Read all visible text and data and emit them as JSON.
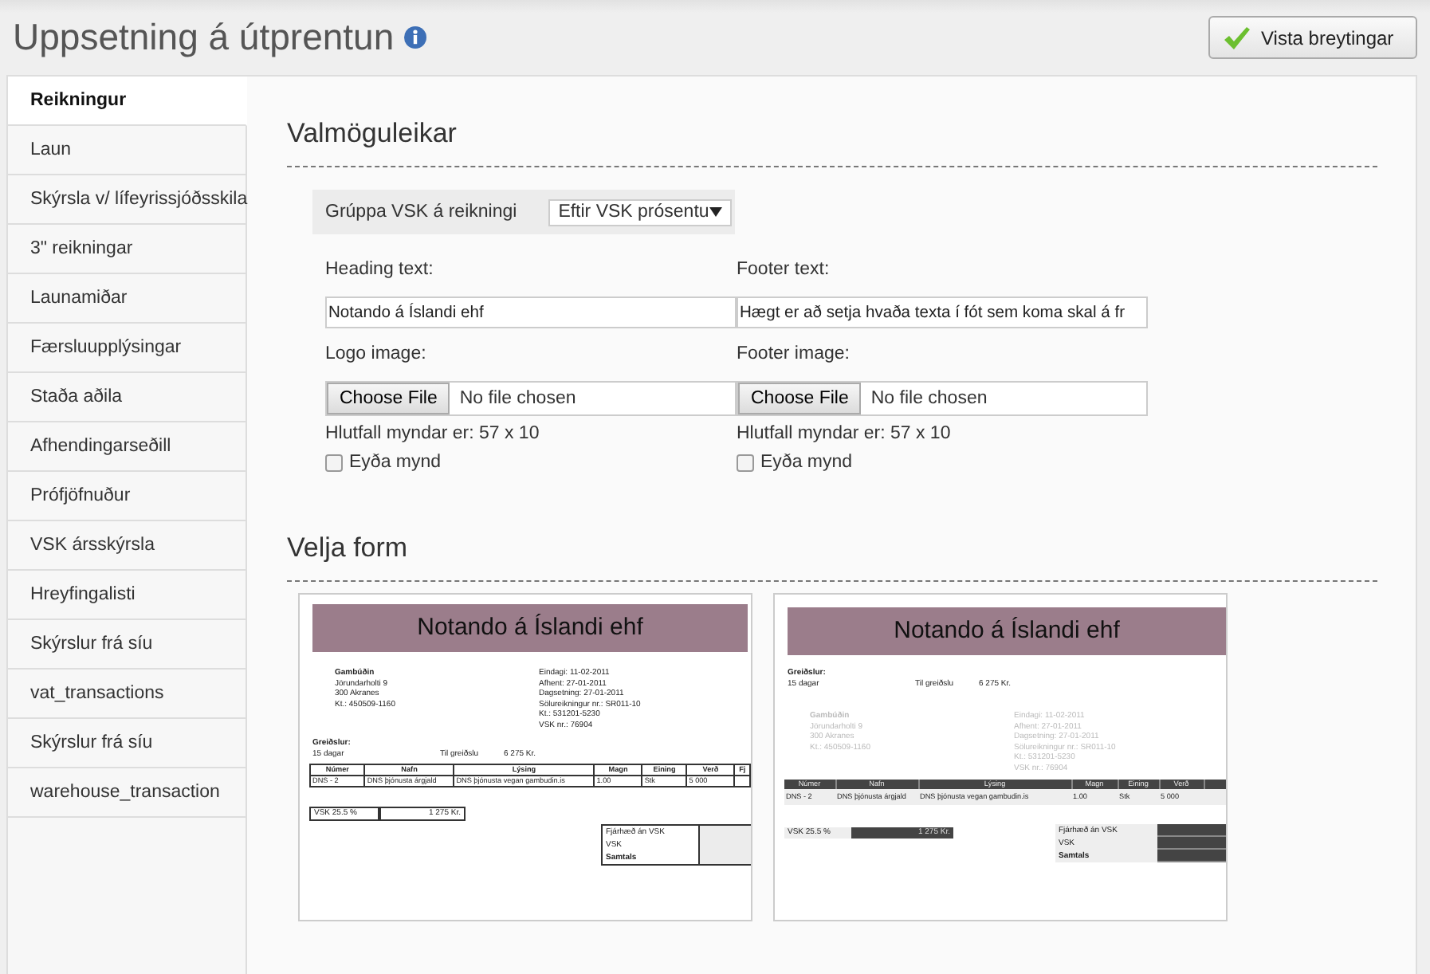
{
  "page": {
    "title": "Uppsetning á útprentun",
    "save_button": "Vista breytingar"
  },
  "sidebar": {
    "items": [
      {
        "label": "Reikningur",
        "selected": true
      },
      {
        "label": "Laun",
        "selected": false
      },
      {
        "label": "Skýrsla v/ lífeyrissjóðsskila",
        "selected": false
      },
      {
        "label": "3\" reikningar",
        "selected": false
      },
      {
        "label": "Launamiðar",
        "selected": false
      },
      {
        "label": "Færsluupplýsingar",
        "selected": false
      },
      {
        "label": "Staða aðila",
        "selected": false
      },
      {
        "label": "Afhendingarseðill",
        "selected": false
      },
      {
        "label": "Prófjöfnuður",
        "selected": false
      },
      {
        "label": "VSK ársskýrsla",
        "selected": false
      },
      {
        "label": "Hreyfingalisti",
        "selected": false
      },
      {
        "label": "Skýrslur frá síu",
        "selected": false
      },
      {
        "label": "vat_transactions",
        "selected": false
      },
      {
        "label": "Skýrslur frá síu",
        "selected": false
      },
      {
        "label": "warehouse_transaction",
        "selected": false
      }
    ]
  },
  "options": {
    "heading": "Valmöguleikar",
    "group_vat": {
      "label": "Grúppa VSK á reikningi",
      "value": "Eftir VSK prósentu"
    },
    "fields": [
      {
        "kind": "text",
        "label": "Heading text:",
        "value": "Notando á Íslandi ehf"
      },
      {
        "kind": "text",
        "label": "Footer text:",
        "value": "Hægt er að setja hvaða texta í fót sem koma skal á fr"
      },
      {
        "kind": "file",
        "label": "Logo image:",
        "button": "Choose File",
        "status": "No file chosen",
        "ratio": "Hlutfall myndar er: 57 x 10",
        "delete": {
          "label": "Eyða mynd",
          "checked": false
        }
      },
      {
        "kind": "file",
        "label": "Footer image:",
        "button": "Choose File",
        "status": "No file chosen",
        "ratio": "Hlutfall myndar er: 57 x 10",
        "delete": {
          "label": "Eyða mynd",
          "checked": false
        }
      }
    ]
  },
  "templates": {
    "heading": "Velja form",
    "items": [
      {
        "kind": "classic",
        "heading": "Notando á Íslandi ehf",
        "customer": [
          "Gambúðin",
          "Jörundarholti 9",
          "300 Akranes",
          "Kt.: 450509-1160"
        ],
        "info": [
          "Eindagi: 11-02-2011",
          "Afhent: 27-01-2011",
          "Dagsetning: 27-01-2011",
          "Sölureikningur nr.: SR011-10",
          "Kt.: 531201-5230",
          "VSK nr.: 76904"
        ],
        "payment": {
          "label": "Greiðslur:",
          "terms": "15 dagar",
          "due_label": "Til greiðslu",
          "amount": "6 275 Kr."
        },
        "columns": [
          "Númer",
          "Nafn",
          "Lýsing",
          "Magn",
          "Eining",
          "Verð",
          "Fj"
        ],
        "row": [
          "DNS - 2",
          "DNS þjónusta árgjald",
          "DNS þjónusta vegan gambudin.is",
          "1.00",
          "Stk",
          "5 000"
        ],
        "vat": {
          "label": "VSK 25.5 %",
          "amount": "1 275 Kr."
        },
        "totals": [
          "Fjárhæð án VSK",
          "VSK",
          "Samtals"
        ]
      },
      {
        "kind": "dark",
        "heading": "Notando á Íslandi ehf",
        "customer": [
          "Gambúðin",
          "Jörundarholti 9",
          "300 Akranes",
          "Kt.: 450509-1160"
        ],
        "info": [
          "Eindagi: 11-02-2011",
          "Afhent: 27-01-2011",
          "Dagsetning: 27-01-2011",
          "Sölureikningur nr.: SR011-10",
          "Kt.: 531201-5230",
          "VSK nr.: 76904"
        ],
        "payment": {
          "label": "Greiðslur:",
          "terms": "15 dagar",
          "due_label": "Til greiðslu",
          "amount": "6 275 Kr."
        },
        "columns": [
          "Númer",
          "Nafn",
          "Lýsing",
          "Magn",
          "Eining",
          "Verð"
        ],
        "row": [
          "DNS - 2",
          "DNS þjónusta árgjald",
          "DNS þjónusta vegan gambudin.is",
          "1.00",
          "Stk",
          "5 000"
        ],
        "vat": {
          "label": "VSK 25.5 %",
          "amount": "1 275 Kr."
        },
        "totals": [
          "Fjárhæð án VSK",
          "VSK",
          "Samtals"
        ]
      }
    ]
  }
}
